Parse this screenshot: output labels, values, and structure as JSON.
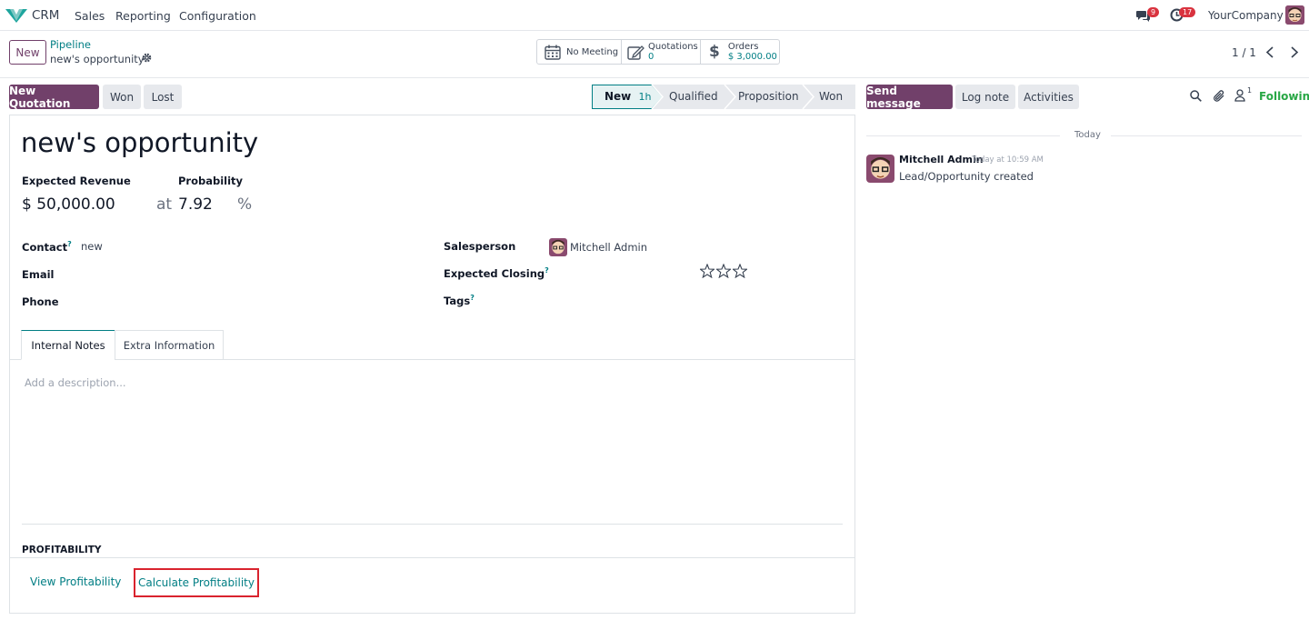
{
  "navbar": {
    "app_name": "CRM",
    "menu": [
      "Sales",
      "Reporting",
      "Configuration"
    ],
    "messages_count": "9",
    "activities_count": "17",
    "company": "YourCompany"
  },
  "control": {
    "new_label": "New",
    "breadcrumb_parent": "Pipeline",
    "breadcrumb_current": "new's opportunity",
    "pager": "1 / 1"
  },
  "stats": {
    "meeting_label": "No Meeting",
    "quotations_label": "Quotations",
    "quotations_value": "0",
    "orders_label": "Orders",
    "orders_value": "$ 3,000.00"
  },
  "actions": {
    "new_quotation": "New Quotation",
    "won": "Won",
    "lost": "Lost"
  },
  "stages": {
    "new": "New",
    "new_time": "1h",
    "qualified": "Qualified",
    "proposition": "Proposition",
    "won": "Won"
  },
  "chatter": {
    "send_message": "Send message",
    "log_note": "Log note",
    "activities": "Activities",
    "followers_count": "1",
    "following": "Following",
    "date_separator": "Today",
    "message_author": "Mitchell Admin",
    "message_time": "Today at 10:59 AM",
    "message_body": "Lead/Opportunity created"
  },
  "form": {
    "title": "new's opportunity",
    "expected_revenue_label": "Expected Revenue",
    "expected_revenue_value": "$ 50,000.00",
    "at_label": "at",
    "probability_label": "Probability",
    "probability_value": "7.92",
    "percent": "%",
    "contact_label": "Contact",
    "contact_value": "new",
    "email_label": "Email",
    "phone_label": "Phone",
    "salesperson_label": "Salesperson",
    "salesperson_value": "Mitchell Admin",
    "expected_closing_label": "Expected Closing",
    "tags_label": "Tags",
    "help_mark": "?",
    "priority_stars": 0
  },
  "tabs": {
    "internal_notes": "Internal Notes",
    "extra_information": "Extra Information",
    "description_placeholder": "Add a description..."
  },
  "profitability": {
    "section_title": "PROFITABILITY",
    "view": "View Profitability",
    "calculate": "Calculate Profitability"
  },
  "colors": {
    "brand": "#71406a",
    "link": "#017e84",
    "highlight_box": "#d9232e",
    "badge": "#d9333f"
  }
}
